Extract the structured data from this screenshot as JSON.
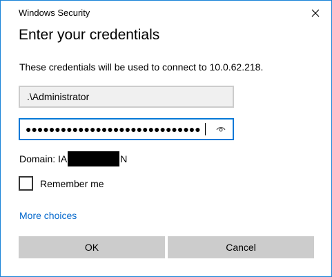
{
  "window": {
    "title": "Windows Security"
  },
  "heading": "Enter your credentials",
  "description": "These credentials will be used to connect to 10.0.62.218.",
  "username": {
    "value": ".\\Administrator"
  },
  "password": {
    "masked_value": "●●●●●●●●●●●●●●●●●●●●●●●●●●●●●●"
  },
  "domain": {
    "prefix": "Domain: IA",
    "suffix": "N"
  },
  "remember": {
    "label": "Remember me",
    "checked": false
  },
  "more_choices": "More choices",
  "buttons": {
    "ok": "OK",
    "cancel": "Cancel"
  },
  "colors": {
    "accent": "#0078d7",
    "frame": "#1883d7",
    "link": "#0066cc",
    "button": "#cccccc",
    "field": "#f0f0f0"
  },
  "icons": {
    "close": "close-icon",
    "reveal": "eye-icon"
  }
}
